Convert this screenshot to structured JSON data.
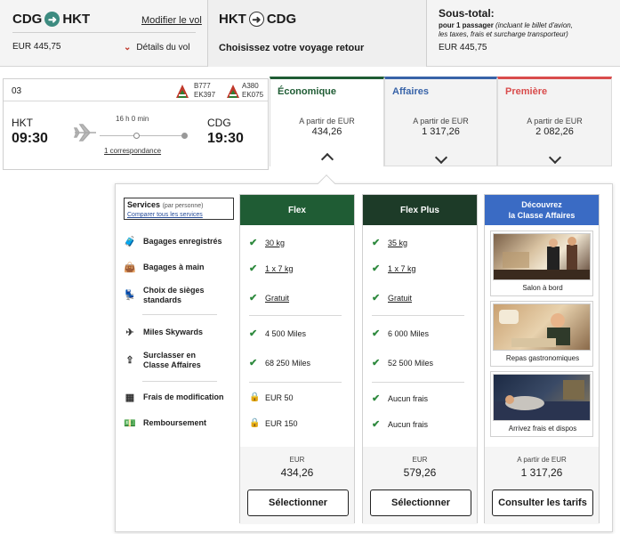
{
  "outbound": {
    "from": "CDG",
    "to": "HKT",
    "modify_link": "Modifier le vol",
    "price": "EUR 445,75",
    "details_link": "Détails du vol"
  },
  "return": {
    "from": "HKT",
    "to": "CDG",
    "subtitle": "Choisissez votre voyage retour"
  },
  "subtotal": {
    "title": "Sous-total:",
    "line1": "pour 1 passager",
    "line1_note": "(incluant le billet d'avion,",
    "line2": "les taxes, frais et surcharge transporteur)",
    "price": "EUR 445,75"
  },
  "flight": {
    "index": "03",
    "aircraft1": "B777",
    "flight1": "EK397",
    "aircraft2": "A380",
    "flight2": "EK075",
    "dep_code": "HKT",
    "dep_time": "09:30",
    "arr_code": "CDG",
    "arr_time": "19:30",
    "duration": "16 h 0 min",
    "connections": "1 correspondance"
  },
  "fares": [
    {
      "name": "Économique",
      "from": "A partir de EUR",
      "amount": "434,26",
      "color": "#1f5c34"
    },
    {
      "name": "Affaires",
      "from": "A partir de EUR",
      "amount": "1 317,26",
      "color": "#3863a8"
    },
    {
      "name": "Première",
      "from": "A partir de EUR",
      "amount": "2 082,26",
      "color": "#d94c4c"
    }
  ],
  "services": {
    "title": "Services",
    "per_person": "(par personne)",
    "compare_link": "Comparer tous les services",
    "rows": [
      {
        "label": "Bagages enregistrés",
        "icon": "checked-bag-icon"
      },
      {
        "label": "Bagages à main",
        "icon": "cabin-bag-icon"
      },
      {
        "label": "Choix de sièges standards",
        "icon": "seat-icon"
      },
      {
        "label": "Miles Skywards",
        "icon": "plane-miles-icon"
      },
      {
        "label": "Surclasser en Classe Affaires",
        "icon": "upgrade-icon"
      },
      {
        "label": "Frais de modification",
        "icon": "calendar-icon"
      },
      {
        "label": "Remboursement",
        "icon": "money-icon"
      }
    ]
  },
  "flex": {
    "title": "Flex",
    "color": "#1f5c34",
    "values": [
      "30 kg",
      "1 x 7 kg",
      "Gratuit",
      "4 500 Miles",
      "68 250 Miles",
      "EUR 50",
      "EUR 150"
    ],
    "currency": "EUR",
    "amount": "434,26",
    "button": "Sélectionner"
  },
  "flexplus": {
    "title": "Flex Plus",
    "color": "#1d3b28",
    "values": [
      "35 kg",
      "1 x 7 kg",
      "Gratuit",
      "6 000 Miles",
      "52 500 Miles",
      "Aucun frais",
      "Aucun frais"
    ],
    "currency": "EUR",
    "amount": "579,26",
    "button": "Sélectionner"
  },
  "business": {
    "title_line1": "Découvrez",
    "title_line2": "la Classe Affaires",
    "color": "#3a6bc4",
    "images": [
      "Salon à bord",
      "Repas gastronomiques",
      "Arrivez frais et dispos"
    ],
    "from": "A partir de EUR",
    "amount": "1 317,26",
    "button": "Consulter les tarifs"
  }
}
